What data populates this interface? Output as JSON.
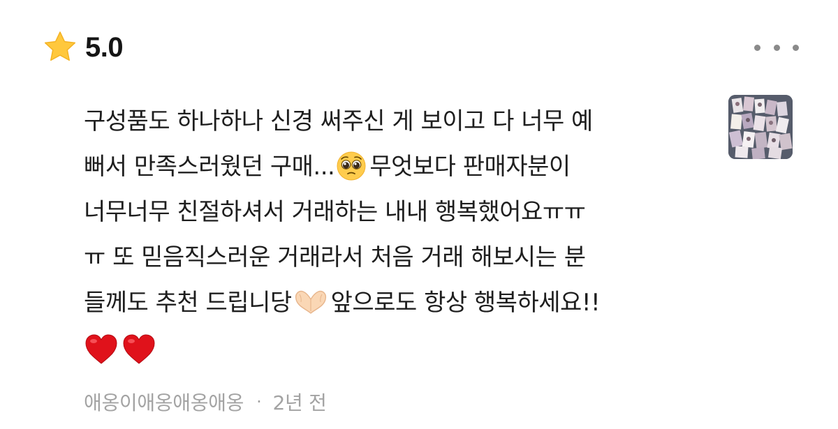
{
  "rating": {
    "icon": "star-icon",
    "score": "5.0",
    "star_color": "#FFC83D"
  },
  "menu": {
    "icon": "more-options-icon"
  },
  "review": {
    "lines": [
      "구성품도 하나하나 신경 써주신 게 보이고 다 너무 예",
      "뻐서 만족스러웠던 구매...",
      "무엇보다 판매자분이",
      "너무너무 친절하셔서 거래하는 내내 행복했어요ㅠㅠ",
      "ㅠ 또 믿음직스러운 거래라서 처음 거래 해보시는 분",
      "들께도 추천 드립니당",
      "앞으로도 항상 행복하세요!!"
    ],
    "emojis": {
      "pleading": "pleading-face-icon",
      "heart_hands": "heart-hands-icon",
      "heart": "red-heart-icon"
    },
    "heart_color": "#E0121B"
  },
  "thumbnail": {
    "icon": "photo-thumbnail"
  },
  "meta": {
    "author": "애옹이애옹애옹애옹",
    "separator": "·",
    "time": "2년 전"
  }
}
